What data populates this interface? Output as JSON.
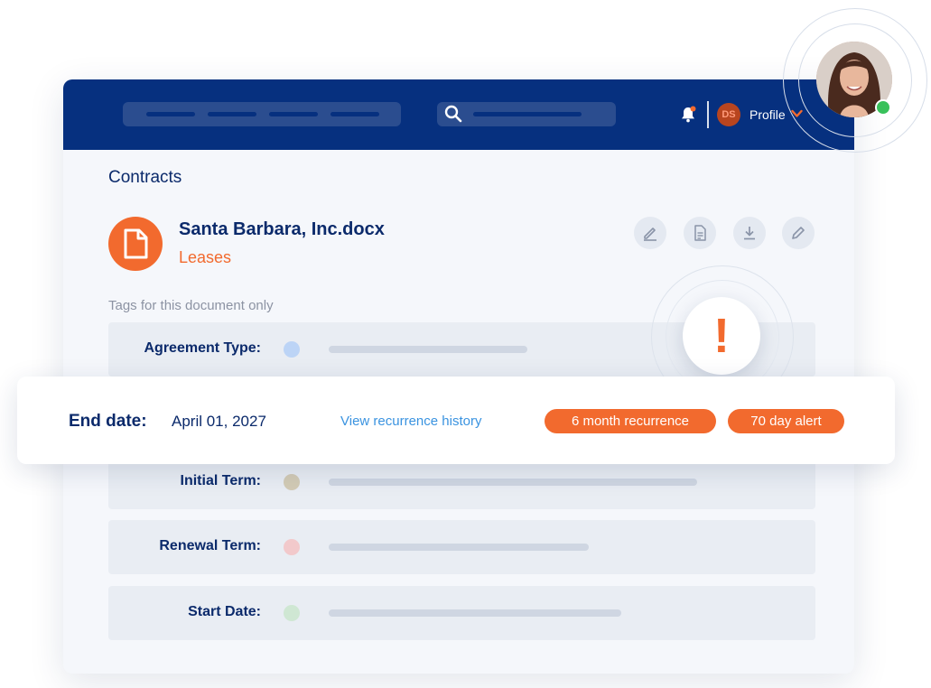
{
  "header": {
    "notification_icon": "bell-icon",
    "search_icon": "search-icon",
    "user_initials": "DS",
    "profile_label": "Profile"
  },
  "main": {
    "section_title": "Contracts",
    "document": {
      "icon": "document-icon",
      "title": "Santa Barbara, Inc.docx",
      "category": "Leases"
    },
    "actions": [
      "edit-icon",
      "document-details-icon",
      "download-icon",
      "pencil-icon"
    ],
    "tags_caption": "Tags for this document only",
    "tags": [
      {
        "label": "Agreement Type:",
        "dot_color": "#bcd4f6"
      },
      {
        "label": "Initial Term:",
        "dot_color": "#d3cbb5"
      },
      {
        "label": "Renewal Term:",
        "dot_color": "#f2c9cb"
      },
      {
        "label": "Start Date:",
        "dot_color": "#cfe7d3"
      }
    ]
  },
  "alert": {
    "symbol": "!"
  },
  "end_date_card": {
    "label": "End date:",
    "value": "April 01, 2027",
    "link": "View recurrence history",
    "badges": [
      "6 month recurrence",
      "70 day alert"
    ]
  },
  "colors": {
    "brand_navy": "#06307f",
    "accent_orange": "#f26a2e",
    "link_blue": "#3a93e0",
    "online_green": "#39c15b"
  }
}
